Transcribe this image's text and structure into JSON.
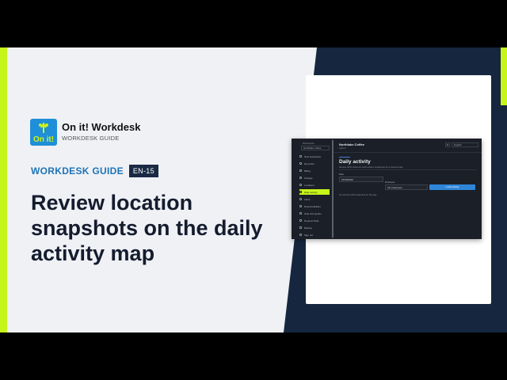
{
  "brand": {
    "logo_text": "On it!",
    "name": "On it! Workdesk",
    "subtitle": "WORKDESK GUIDE"
  },
  "guide": {
    "label": "WORKDESK GUIDE",
    "badge": "EN-15"
  },
  "headline": "Review location snapshots on the daily activity map",
  "colors": {
    "accent_green": "#c6f51a",
    "navy": "#16263f",
    "blue": "#1d73b6",
    "panel": "#eff1f5"
  },
  "app": {
    "sidebar": {
      "top_label": "Workspace",
      "org_select": "Northlake Coffee",
      "items": [
        {
          "label": "New workspace",
          "icon": "plus-icon"
        },
        {
          "label": "Recordes",
          "icon": "list-icon"
        },
        {
          "label": "Billing",
          "icon": "card-icon"
        },
        {
          "label": "Storage",
          "icon": "box-icon"
        },
        {
          "label": "Locations",
          "icon": "pin-icon"
        },
        {
          "label": "Daily activity",
          "icon": "map-icon",
          "active": true
        },
        {
          "label": "Alerts",
          "icon": "bell-icon"
        },
        {
          "label": "Responsibilities",
          "icon": "check-icon"
        },
        {
          "label": "Help and guides",
          "icon": "help-icon"
        },
        {
          "label": "Request Data",
          "icon": "download-icon"
        },
        {
          "label": "Backup",
          "icon": "backup-icon"
        },
        {
          "label": "Sign out",
          "icon": "logout-icon"
        }
      ]
    },
    "header": {
      "org_name": "Northlake Coffee",
      "org_sub": "Admin",
      "language": "English"
    },
    "page": {
      "title": "Daily activity",
      "subtitle": "Review GPS check-ins and location snapshots for a selected day",
      "date_label": "Date",
      "date_value": "01/08/2024",
      "employee_label": "Employee",
      "employee_value": "All employees",
      "load_button": "Load activity",
      "empty_text": "No activity GPS snapshots for this day"
    }
  }
}
